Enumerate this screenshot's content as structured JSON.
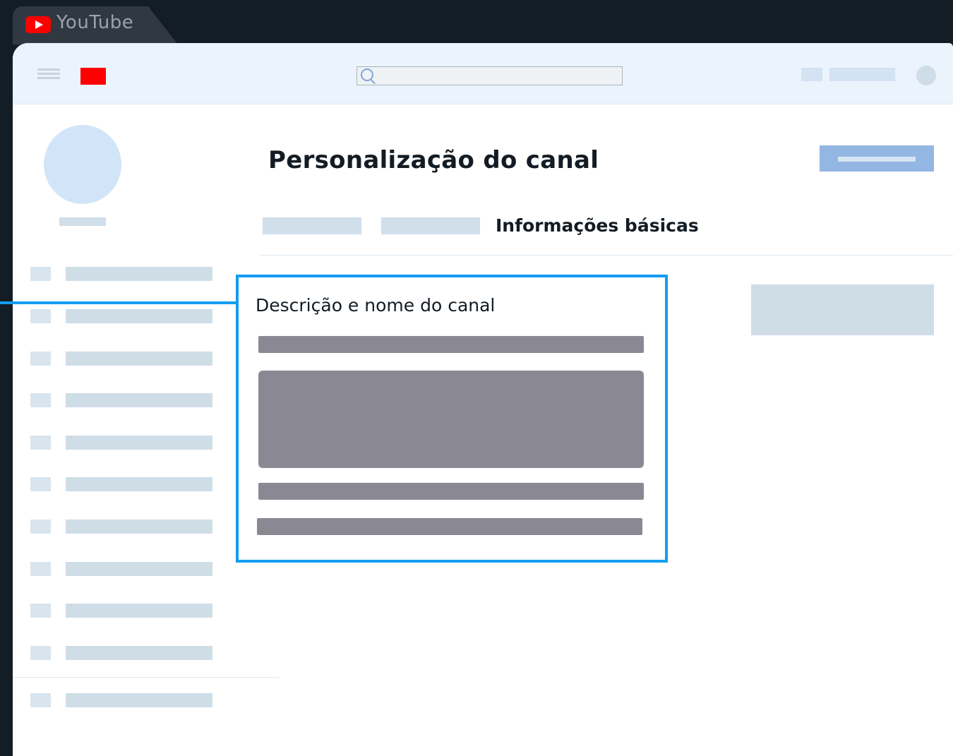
{
  "browser": {
    "tab_title": "YouTube"
  },
  "page": {
    "title": "Personalização do canal",
    "active_tab": "Informações básicas",
    "section_title": "Descrição e nome do canal"
  },
  "colors": {
    "highlight": "#149cf0",
    "brand_red": "#ff0000",
    "primary_button": "#93b6e2",
    "field_placeholder": "#8a8893"
  },
  "icons": [
    "youtube-logo-icon",
    "menu-icon",
    "search-icon",
    "avatar-icon"
  ]
}
